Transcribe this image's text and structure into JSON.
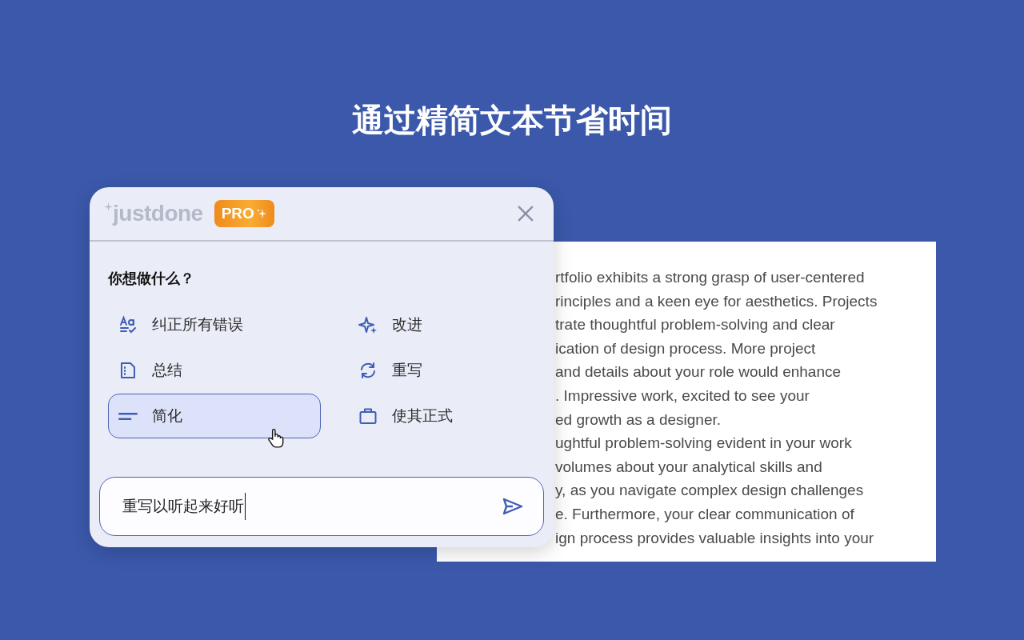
{
  "title": "通过精简文本节省时间",
  "panel": {
    "logo": "justdone",
    "badge": "PRO",
    "question": "你想做什么？",
    "options": [
      {
        "label": "纠正所有错误",
        "kind": "spellcheck",
        "selected": false
      },
      {
        "label": "改进",
        "kind": "sparkle",
        "selected": false
      },
      {
        "label": "总结",
        "kind": "document",
        "selected": false
      },
      {
        "label": "重写",
        "kind": "refresh",
        "selected": false
      },
      {
        "label": "简化",
        "kind": "lines",
        "selected": true
      },
      {
        "label": "使其正式",
        "kind": "briefcase",
        "selected": false
      }
    ],
    "input": {
      "value": "重写以听起来好听"
    }
  },
  "document": {
    "lines": [
      "rtfolio exhibits a strong grasp of user-centered",
      "rinciples and a keen eye for aesthetics. Projects",
      "trate thoughtful problem-solving and clear",
      "ication of design process. More project",
      "and details about your role would enhance",
      ". Impressive work, excited to see your",
      "ed growth as a designer.",
      "ughtful problem-solving evident in your work",
      "volumes about your analytical skills and",
      "y, as you navigate complex design challenges",
      "e. Furthermore, your clear communication of",
      "ign process provides valuable insights into your"
    ]
  }
}
